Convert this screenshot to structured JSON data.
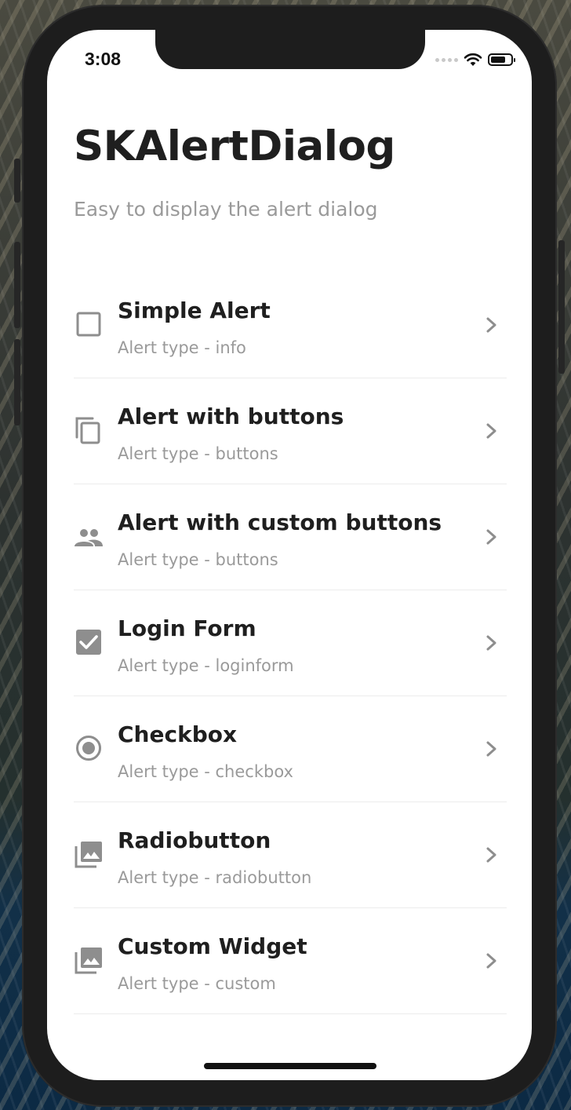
{
  "status_bar": {
    "time": "3:08"
  },
  "header": {
    "title": "SKAlertDialog",
    "subtitle": "Easy to display the alert dialog"
  },
  "items": [
    {
      "title": "Simple Alert",
      "subtitle": "Alert type - info",
      "icon": "crop-square-icon"
    },
    {
      "title": "Alert with buttons",
      "subtitle": "Alert type - buttons",
      "icon": "copy-icon"
    },
    {
      "title": "Alert with custom buttons",
      "subtitle": "Alert type - buttons",
      "icon": "people-icon"
    },
    {
      "title": "Login Form",
      "subtitle": "Alert type - loginform",
      "icon": "check-box-icon"
    },
    {
      "title": "Checkbox",
      "subtitle": "Alert type - checkbox",
      "icon": "radio-button-checked-icon"
    },
    {
      "title": "Radiobutton",
      "subtitle": "Alert type - radiobutton",
      "icon": "photo-library-icon"
    },
    {
      "title": "Custom Widget",
      "subtitle": "Alert type - custom",
      "icon": "photo-library-icon"
    }
  ],
  "colors": {
    "title_text": "#1f1f1f",
    "secondary_text": "#9a9a9a",
    "icon": "#8e8e8e",
    "divider": "#ececec"
  }
}
